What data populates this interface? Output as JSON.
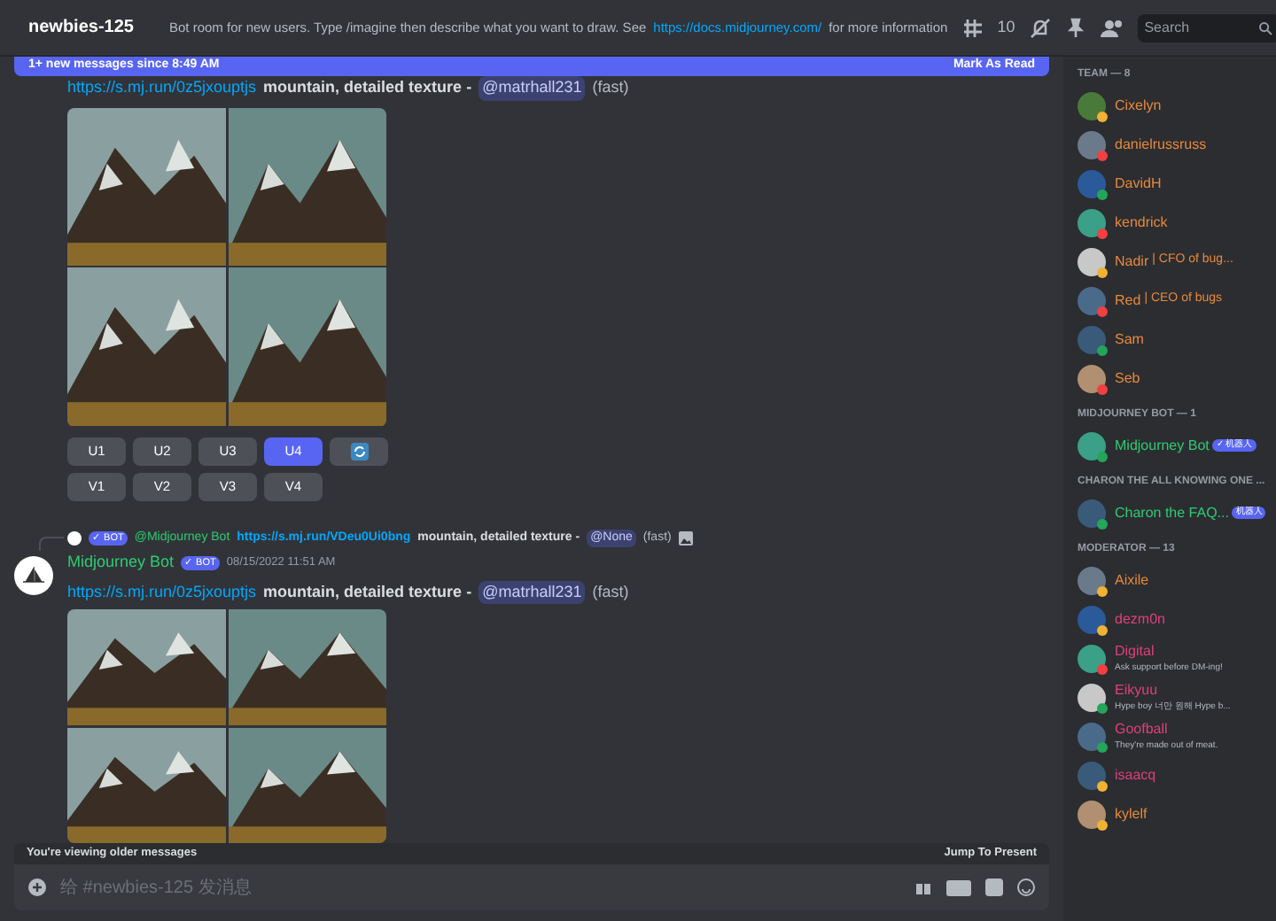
{
  "header": {
    "channel": "newbies-125",
    "topic": "Bot room for new users. Type /imagine then describe what you want to draw. See",
    "topic_link": "https://docs.midjourney.com/",
    "topic_end": "for more information",
    "thread_count": "10",
    "search_placeholder": "Search"
  },
  "banner": {
    "text": "1+ new messages since 8:49 AM",
    "action": "Mark As Read"
  },
  "first_message": {
    "link": "https://s.mj.run/0z5jxouptjs",
    "prompt": "mountain, detailed texture -",
    "mention": "@matrhall231",
    "mode": "(fast)",
    "button_rows": [
      [
        {
          "kind": "text",
          "label": "U1",
          "selected": false
        },
        {
          "kind": "text",
          "label": "U2",
          "selected": false
        },
        {
          "kind": "text",
          "label": "U3",
          "selected": false
        },
        {
          "kind": "text",
          "label": "U4",
          "selected": true
        },
        {
          "kind": "icon",
          "selected": false
        }
      ],
      [
        {
          "kind": "text",
          "label": "V1",
          "selected": false
        },
        {
          "kind": "text",
          "label": "V2",
          "selected": false
        },
        {
          "kind": "text",
          "label": "V3",
          "selected": false
        },
        {
          "kind": "text",
          "label": "V4",
          "selected": false
        }
      ]
    ]
  },
  "second_message": {
    "reply": {
      "badge": "✓ BOT",
      "author": "@Midjourney Bot",
      "link": "https://s.mj.run/VDeu0Ui0bng",
      "prompt": "mountain, detailed texture -",
      "mention": "@None",
      "mode": "(fast)"
    },
    "author": "Midjourney Bot",
    "badge": "✓ BOT",
    "time": "08/15/2022 11:51 AM",
    "link": "https://s.mj.run/0z5jxouptjs",
    "prompt": "mountain, detailed texture -",
    "mention": "@matrhall231",
    "mode": "(fast)"
  },
  "footer": {
    "notice": "You're viewing older messages",
    "jump": "Jump To Present",
    "placeholder": "给 #newbies-125 发消息"
  },
  "member_groups": [
    {
      "title": "TEAM — 8",
      "members": [
        {
          "name": "Cixelyn",
          "kind": "team",
          "color": "#f0b232"
        },
        {
          "name": "danielrussruss",
          "kind": "team",
          "color": "#f23f43"
        },
        {
          "name": "DavidH",
          "kind": "team",
          "color": "#23a55a"
        },
        {
          "name": "kendrick",
          "kind": "team",
          "color": "#f23f43"
        },
        {
          "name": "Nadir",
          "suffix": "| CFO of bug...",
          "kind": "team",
          "color": "#f0b232"
        },
        {
          "name": "Red",
          "suffix": "| CEO of bugs",
          "kind": "team",
          "color": "#f23f43"
        },
        {
          "name": "Sam",
          "kind": "team",
          "color": "#23a55a"
        },
        {
          "name": "Seb",
          "kind": "team",
          "color": "#f23f43"
        }
      ]
    },
    {
      "title": "MIDJOURNEY BOT — 1",
      "members": [
        {
          "name": "Midjourney Bot",
          "badge": "✓ 机器人",
          "kind": "bot",
          "color": "#23a55a"
        }
      ]
    },
    {
      "title": "CHARON THE ALL KNOWING ONE ...",
      "members": [
        {
          "name": "Charon the FAQ...",
          "badge": "机器人",
          "kind": "bot",
          "color": "#23a55a"
        }
      ]
    },
    {
      "title": "MODERATOR — 13",
      "members": [
        {
          "name": "Aixile",
          "kind": "team",
          "color": "#f0b232"
        },
        {
          "name": "dezm0n",
          "kind": "moderator",
          "color": "#f0b232"
        },
        {
          "name": "Digital",
          "subtitle": "Ask support before DM-ing!",
          "kind": "moderator",
          "color": "#f23f43"
        },
        {
          "name": "Eikyuu",
          "subtitle": "Hype boy 너만 원해 Hype b...",
          "kind": "moderator",
          "color": "#23a55a"
        },
        {
          "name": "Goofball",
          "subtitle": "They're made out of meat.",
          "kind": "moderator",
          "color": "#23a55a"
        },
        {
          "name": "isaacq",
          "kind": "moderator",
          "color": "#f0b232"
        },
        {
          "name": "kylelf",
          "kind": "team",
          "color": "#f0b232"
        }
      ]
    }
  ]
}
